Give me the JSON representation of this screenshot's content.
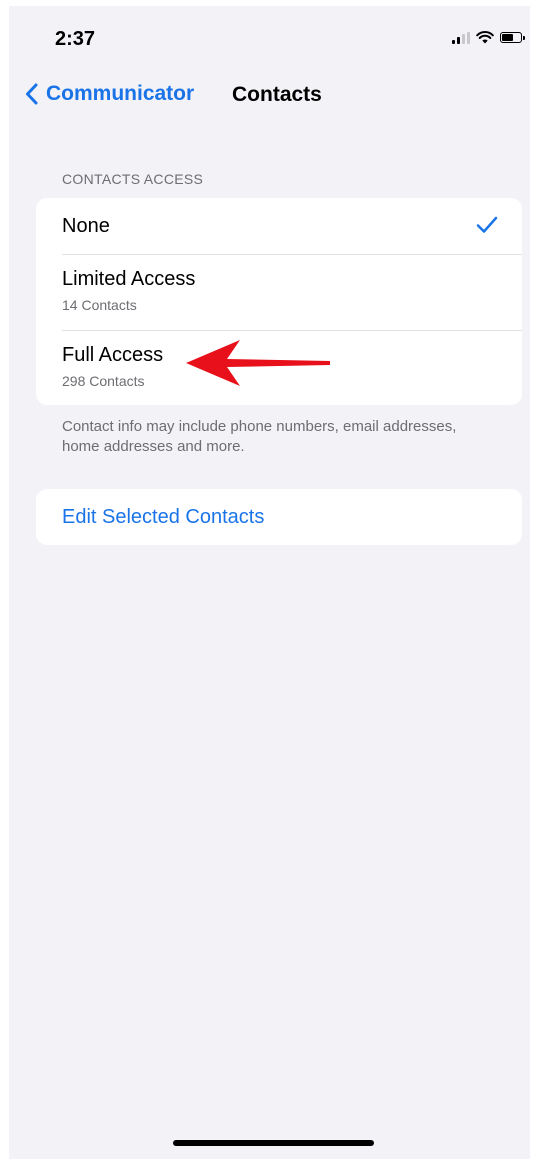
{
  "status_bar": {
    "time": "2:37",
    "icons": [
      "signal-icon",
      "wifi-icon",
      "battery-icon"
    ]
  },
  "nav": {
    "back_label": "Communicator",
    "title": "Contacts"
  },
  "contacts_access": {
    "header": "CONTACTS ACCESS",
    "options": [
      {
        "label": "None",
        "subtitle": "",
        "selected": true
      },
      {
        "label": "Limited Access",
        "subtitle": "14 Contacts",
        "selected": false
      },
      {
        "label": "Full Access",
        "subtitle": "298 Contacts",
        "selected": false
      }
    ],
    "footer": "Contact info may include phone numbers, email addresses, home addresses and more."
  },
  "edit_section": {
    "button_label": "Edit Selected Contacts"
  },
  "colors": {
    "accent": "#1a74e8",
    "background": "#f2f2f7",
    "annotation_arrow": "#e8101a"
  }
}
